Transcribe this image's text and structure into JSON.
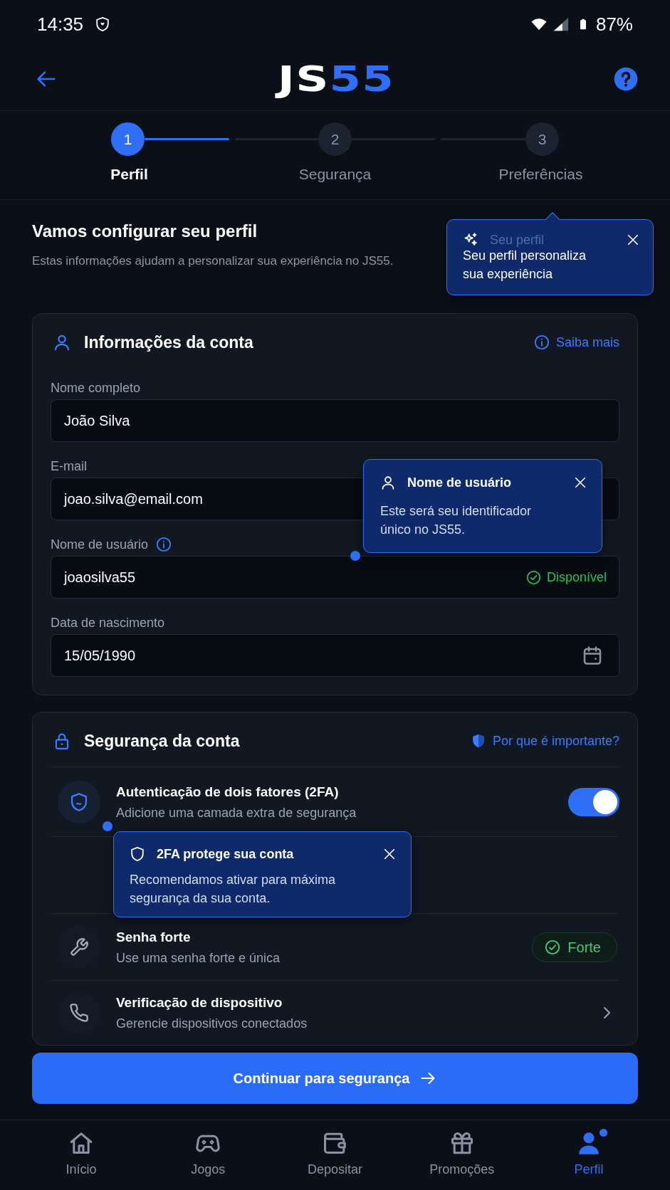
{
  "status_bar": {
    "time": "14:35",
    "battery": "87%"
  },
  "header": {
    "logo": [
      {
        "text": "JS",
        "color": "#ffffff"
      },
      {
        "text": "55",
        "color": "#2f6ff6"
      }
    ]
  },
  "stepper": {
    "steps": [
      {
        "number": "1",
        "label": "Perfil",
        "selected": true
      },
      {
        "number": "2",
        "label": "Segurança",
        "selected": false
      },
      {
        "number": "3",
        "label": "Preferências",
        "selected": false
      }
    ]
  },
  "intro": {
    "title": "Vamos configurar seu perfil",
    "subtitle": "Estas informações ajudam a personalizar sua experiência no JS55.",
    "tooltip": {
      "title": "Seu perfil",
      "text": "Seu perfil personaliza sua experiência"
    }
  },
  "account_card": {
    "title": "Informações da conta",
    "link": "Saiba mais",
    "fields": [
      {
        "kind": "text",
        "label": "Nome completo",
        "value": "João Silva"
      },
      {
        "kind": "text",
        "label": "E-mail",
        "value": "joao.silva@email.com"
      },
      {
        "kind": "username",
        "label": "Nome de usuário",
        "value": "joaosilva55",
        "status": "Disponível",
        "tooltip": {
          "title": "Nome de usuário",
          "text": "Este será seu identificador único no JS55."
        }
      },
      {
        "kind": "date",
        "label": "Data de nascimento",
        "value": "15/05/1990"
      }
    ]
  },
  "security_card": {
    "title": "Segurança da conta",
    "link": "Por que é importante?",
    "items": [
      {
        "kind": "toggle",
        "title": "Autenticação de dois fatores (2FA)",
        "subtitle": "Adicione uma camada extra de segurança",
        "on": true,
        "tooltip": {
          "title": "2FA protege sua conta",
          "text": "Recomendamos ativar para máxima segurança da sua conta."
        }
      },
      {
        "kind": "badge",
        "title": "Senha forte",
        "subtitle": "Use uma senha forte e única",
        "badge": "Forte"
      },
      {
        "kind": "link",
        "title": "Verificação de dispositivo",
        "subtitle": "Gerencie dispositivos conectados"
      }
    ]
  },
  "continue_button": {
    "label": "Continuar para segurança"
  },
  "bottom_nav": {
    "items": [
      {
        "label": "Início",
        "selected": false,
        "notification": false
      },
      {
        "label": "Jogos",
        "selected": false,
        "notification": false
      },
      {
        "label": "Depositar",
        "selected": false,
        "notification": false
      },
      {
        "label": "Promoções",
        "selected": false,
        "notification": false
      },
      {
        "label": "Perfil",
        "selected": true,
        "notification": true
      }
    ]
  }
}
